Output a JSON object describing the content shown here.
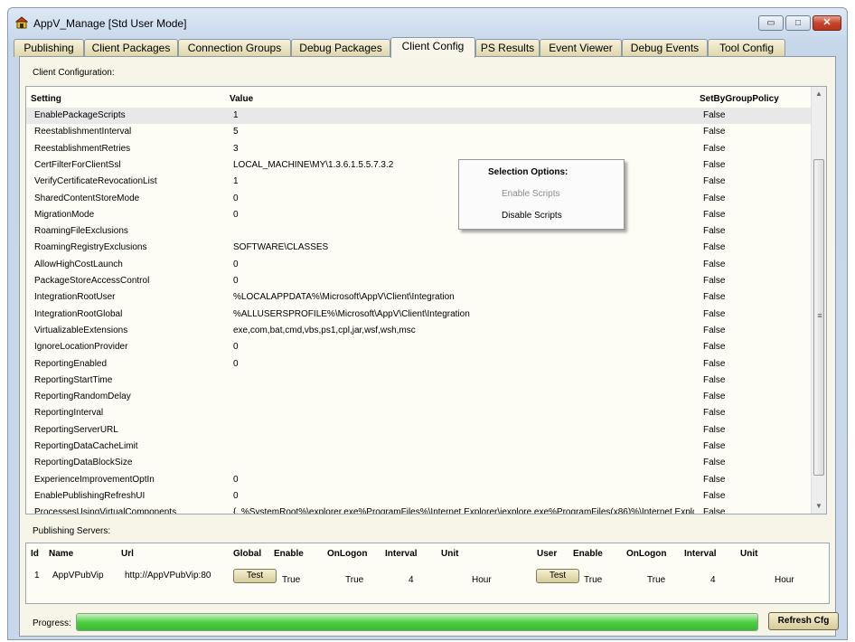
{
  "window": {
    "title": "AppV_Manage [Std User Mode]",
    "min_glyph": "▭",
    "max_glyph": "□",
    "close_glyph": "✕"
  },
  "tabs": [
    "Publishing",
    "Client Packages",
    "Connection Groups",
    "Debug Packages",
    "Client Config",
    "PS Results",
    "Event Viewer",
    "Debug Events",
    "Tool Config"
  ],
  "active_tab": "Client Config",
  "client_config": {
    "label": "Client Configuration:",
    "columns": [
      "Setting",
      "Value",
      "SetByGroupPolicy"
    ],
    "rows": [
      [
        "EnablePackageScripts",
        "1",
        "False"
      ],
      [
        "ReestablishmentInterval",
        "5",
        "False"
      ],
      [
        "ReestablishmentRetries",
        "3",
        "False"
      ],
      [
        "CertFilterForClientSsl",
        "LOCAL_MACHINE\\MY\\1.3.6.1.5.5.7.3.2",
        "False"
      ],
      [
        "VerifyCertificateRevocationList",
        "1",
        "False"
      ],
      [
        "SharedContentStoreMode",
        "0",
        "False"
      ],
      [
        "MigrationMode",
        "0",
        "False"
      ],
      [
        "RoamingFileExclusions",
        "",
        "False"
      ],
      [
        "RoamingRegistryExclusions",
        "SOFTWARE\\CLASSES",
        "False"
      ],
      [
        "AllowHighCostLaunch",
        "0",
        "False"
      ],
      [
        "PackageStoreAccessControl",
        "0",
        "False"
      ],
      [
        "IntegrationRootUser",
        "%LOCALAPPDATA%\\Microsoft\\AppV\\Client\\Integration",
        "False"
      ],
      [
        "IntegrationRootGlobal",
        "%ALLUSERSPROFILE%\\Microsoft\\AppV\\Client\\Integration",
        "False"
      ],
      [
        "VirtualizableExtensions",
        "exe,com,bat,cmd,vbs,ps1,cpl,jar,wsf,wsh,msc",
        "False"
      ],
      [
        "IgnoreLocationProvider",
        "0",
        "False"
      ],
      [
        "ReportingEnabled",
        "0",
        "False"
      ],
      [
        "ReportingStartTime",
        "",
        "False"
      ],
      [
        "ReportingRandomDelay",
        "",
        "False"
      ],
      [
        "ReportingInterval",
        "",
        "False"
      ],
      [
        "ReportingServerURL",
        "",
        "False"
      ],
      [
        "ReportingDataCacheLimit",
        "",
        "False"
      ],
      [
        "ReportingDataBlockSize",
        "",
        "False"
      ],
      [
        "ExperienceImprovementOptIn",
        "0",
        "False"
      ],
      [
        "EnablePublishingRefreshUI",
        "0",
        "False"
      ],
      [
        "ProcessesUsingVirtualComponents",
        "{, %SystemRoot%\\explorer.exe%ProgramFiles%\\Internet Explorer\\iexplore.exe%ProgramFiles(x86)%\\Internet Explorer\\iexplore.exe}",
        "False"
      ]
    ],
    "selected_row": 0
  },
  "context_menu": {
    "title": "Selection Options:",
    "items": [
      "Enable Scripts",
      "Disable Scripts"
    ]
  },
  "publishing_servers": {
    "label": "Publishing Servers:",
    "columns": [
      "Id",
      "Name",
      "Url",
      "Global",
      "Enable",
      "OnLogon",
      "Interval",
      "Unit",
      "User",
      "Enable",
      "OnLogon",
      "Interval",
      "Unit"
    ],
    "row": {
      "id": "1",
      "name": "AppVPubVip",
      "url": "http://AppVPubVip:80",
      "global_button": "Test",
      "global_enable": "True",
      "global_onlogon": "True",
      "global_interval": "4",
      "global_unit": "Hour",
      "user_button": "Test",
      "user_enable": "True",
      "user_onlogon": "True",
      "user_interval": "4",
      "user_unit": "Hour"
    }
  },
  "progress": {
    "label": "Progress:",
    "value": 1.0
  },
  "refresh_button": "Refresh Cfg",
  "colors": {
    "progress": "#4fcf44",
    "close": "#c6442b",
    "tab": "#ddd5a8"
  }
}
